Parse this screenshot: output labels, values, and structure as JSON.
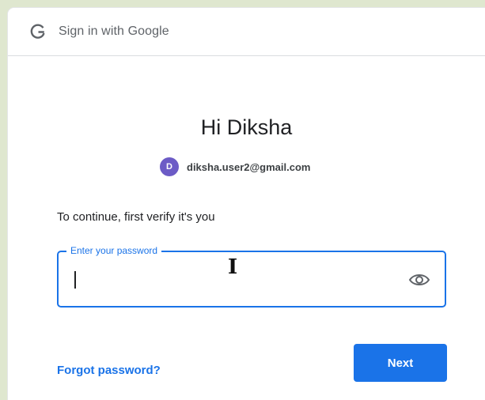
{
  "header": {
    "logo_icon": "google-g-icon",
    "title": "Sign in with Google"
  },
  "greeting": "Hi Diksha",
  "account": {
    "avatar_letter": "D",
    "avatar_color": "#6c5bc6",
    "email": "diksha.user2@gmail.com"
  },
  "instruction": "To continue, first verify it's you",
  "password": {
    "label": "Enter your password",
    "value": "",
    "toggle_icon": "eye-icon"
  },
  "actions": {
    "forgot_label": "Forgot password?",
    "next_label": "Next"
  },
  "colors": {
    "accent": "#1a73e8",
    "background": "#dfe7cf"
  }
}
